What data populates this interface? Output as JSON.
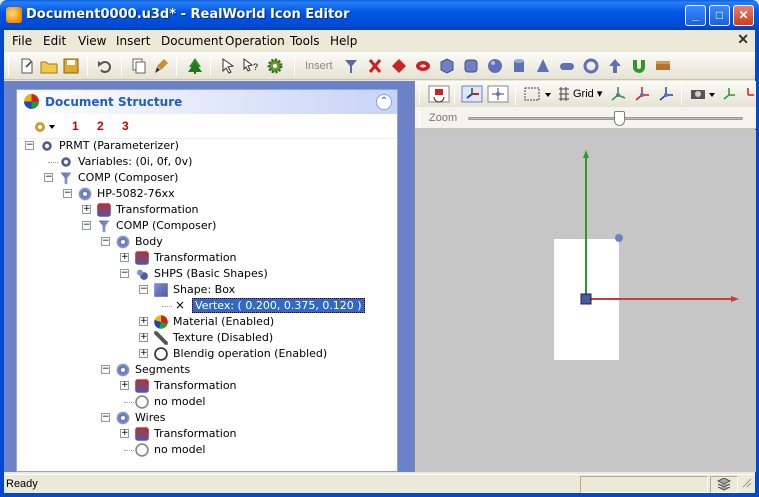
{
  "window": {
    "title": "Document0000.u3d* - RealWorld Icon Editor",
    "minimize": "_",
    "maximize": "□",
    "close": "✕"
  },
  "menu": {
    "items": [
      "File",
      "Edit",
      "View",
      "Insert",
      "Document",
      "Operation",
      "Tools",
      "Help"
    ],
    "underline": [
      "F",
      "E",
      "V",
      "I",
      "D",
      "O",
      "T",
      "H"
    ],
    "close": "✕"
  },
  "toolbar": {
    "insert_label": "Insert",
    "icons": [
      "new-document-icon",
      "open-folder-icon",
      "save-icon",
      "undo-icon",
      "copy-icon",
      "paint-brush-icon",
      "tree-icon",
      "pointer-icon",
      "help-pointer-icon",
      "settings-icon"
    ],
    "insert_icons": [
      "connector-icon",
      "red-x-icon",
      "red-diamond-icon",
      "torus-icon",
      "cube-icon",
      "rounded-cube-icon",
      "sphere-icon",
      "cylinder-icon",
      "cone-icon",
      "capsule-icon",
      "ring-icon",
      "arrow-up-icon",
      "magnet-icon",
      "box-icon"
    ]
  },
  "doc_panel": {
    "title": "Document Structure",
    "toolbar_numbers": [
      "1",
      "2",
      "3"
    ]
  },
  "tree": [
    {
      "label": "PRMT (Parameterizer)",
      "level": 0,
      "exp": "−",
      "icon": "gear"
    },
    {
      "label": "Variables: (0i, 0f, 0v)",
      "level": 1,
      "exp": "",
      "icon": "gear"
    },
    {
      "label": "COMP (Composer)",
      "level": 1,
      "exp": "−",
      "icon": "comp"
    },
    {
      "label": "HP-5082-76xx",
      "level": 2,
      "exp": "−",
      "icon": "ring"
    },
    {
      "label": "Transformation",
      "level": 3,
      "exp": "+",
      "icon": "trans"
    },
    {
      "label": "COMP (Composer)",
      "level": 3,
      "exp": "−",
      "icon": "comp"
    },
    {
      "label": "Body",
      "level": 4,
      "exp": "−",
      "icon": "ring"
    },
    {
      "label": "Transformation",
      "level": 5,
      "exp": "+",
      "icon": "trans"
    },
    {
      "label": "SHPS (Basic Shapes)",
      "level": 5,
      "exp": "−",
      "icon": "shapes"
    },
    {
      "label": "Shape: Box",
      "level": 6,
      "exp": "−",
      "icon": "cube"
    },
    {
      "label": "Vertex: ( 0.200, 0.375, 0.120 )",
      "level": 7,
      "exp": "",
      "icon": "x",
      "selected": true
    },
    {
      "label": "Material (Enabled)",
      "level": 6,
      "exp": "+",
      "icon": "mat"
    },
    {
      "label": "Texture (Disabled)",
      "level": 6,
      "exp": "+",
      "icon": "tex"
    },
    {
      "label": "Blendig operation (Enabled)",
      "level": 6,
      "exp": "+",
      "icon": "blend"
    },
    {
      "label": "Segments",
      "level": 4,
      "exp": "−",
      "icon": "ring"
    },
    {
      "label": "Transformation",
      "level": 5,
      "exp": "+",
      "icon": "trans"
    },
    {
      "label": "no model",
      "level": 5,
      "exp": "",
      "icon": "none"
    },
    {
      "label": "Wires",
      "level": 4,
      "exp": "−",
      "icon": "ring"
    },
    {
      "label": "Transformation",
      "level": 5,
      "exp": "+",
      "icon": "trans"
    },
    {
      "label": "no model",
      "level": 5,
      "exp": "",
      "icon": "none"
    }
  ],
  "view": {
    "grid_label": "Grid",
    "zoom_label": "Zoom",
    "zoom_level": 0.55
  },
  "status": {
    "text": "Ready"
  },
  "colors": {
    "accent": "#215dc6",
    "titlebar": "#0058e6",
    "selection": "#316ac5",
    "axis_y": "#2a9a2a",
    "axis_x": "#c04040"
  }
}
